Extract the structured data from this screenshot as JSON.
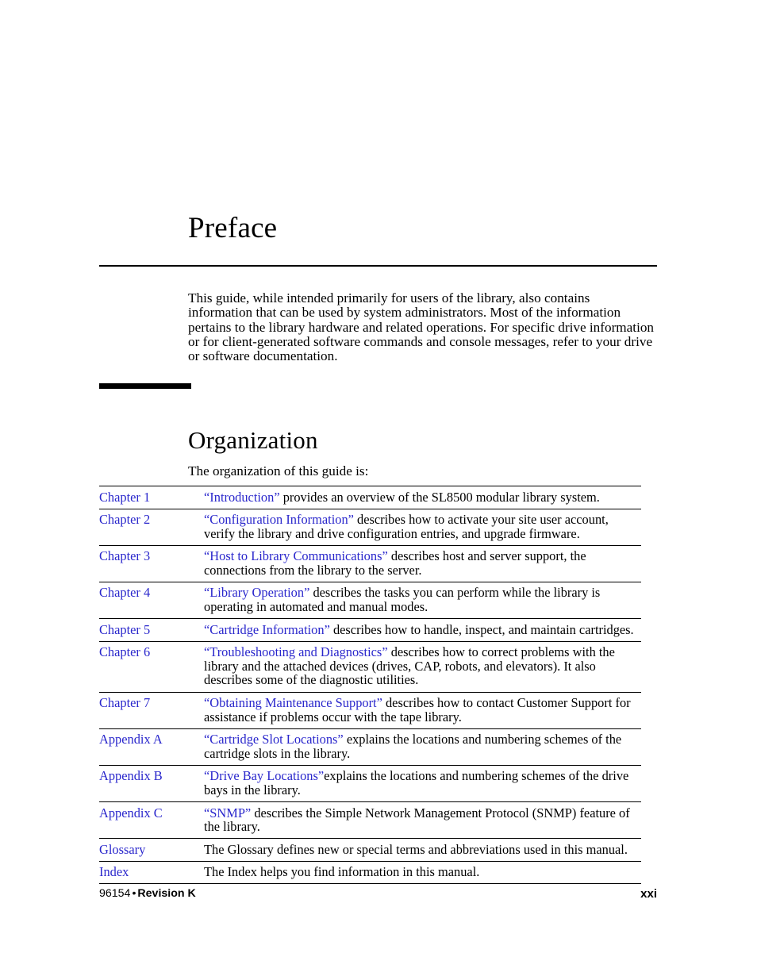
{
  "page": {
    "chapter_title": "Preface",
    "intro_paragraph": "This guide, while intended primarily for users of the library, also contains information that can be used by system administrators. Most of the information pertains to the library hardware and related operations. For specific drive information or for client-generated software commands and console messages, refer to your drive or software documentation."
  },
  "section": {
    "heading": "Organization",
    "lead_in": "The organization of this guide is:"
  },
  "org_table": {
    "rows": [
      {
        "label": "Chapter 1",
        "xref": "“Introduction”",
        "tail": " provides an overview of the SL8500 modular library system."
      },
      {
        "label": "Chapter 2",
        "xref": "“Configuration Information”",
        "tail": " describes how to activate your site user account, verify the library and drive configuration entries, and upgrade firmware."
      },
      {
        "label": "Chapter 3",
        "xref": "“Host to Library Communications”",
        "tail": " describes host and server support, the connections from the library to the server."
      },
      {
        "label": "Chapter 4",
        "xref": "“Library Operation”",
        "tail": " describes the tasks you can perform while the library is operating in automated and manual modes."
      },
      {
        "label": "Chapter 5",
        "xref": "“Cartridge Information”",
        "tail": " describes how to handle, inspect, and maintain cartridges."
      },
      {
        "label": "Chapter 6",
        "xref": "“Troubleshooting and Diagnostics”",
        "tail": " describes how to correct problems with the library and the attached devices (drives, CAP, robots, and elevators). It also describes some of the diagnostic utilities."
      },
      {
        "label": "Chapter 7",
        "xref": "“Obtaining Maintenance Support”",
        "tail": " describes how to contact Customer Support for assistance if problems occur with the tape library."
      },
      {
        "label": "Appendix A",
        "xref": "“Cartridge Slot Locations”",
        "tail": " explains the locations and numbering schemes of the cartridge slots in the library."
      },
      {
        "label": "Appendix B",
        "xref": "“Drive Bay Locations”",
        "tail": "explains the locations and numbering schemes of the drive bays in the library."
      },
      {
        "label": "Appendix C",
        "xref": "“SNMP”",
        "tail": " describes the Simple Network Management Protocol (SNMP) feature of the library."
      },
      {
        "label": "Glossary",
        "xref": "",
        "tail": "The Glossary defines new or special terms and abbreviations used in this manual."
      },
      {
        "label": "Index",
        "xref": "",
        "tail": "The Index helps you find information in this manual."
      }
    ]
  },
  "footer": {
    "doc_number": "96154",
    "separator": "•",
    "revision": "Revision K",
    "page_number": "xxi"
  },
  "colors": {
    "link_blue": "#2a27cc",
    "text_black": "#000000",
    "page_background": "#ffffff"
  }
}
